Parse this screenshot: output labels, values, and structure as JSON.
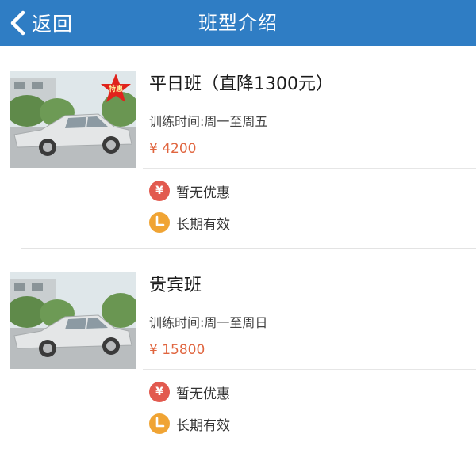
{
  "header": {
    "back_label": "返回",
    "title": "班型介绍",
    "color": "#2f7dc4"
  },
  "classes": [
    {
      "name": "平日班（直降1300元）",
      "schedule": "训练时间:周一至周五",
      "price": "¥ 4200",
      "promo_tag": "特惠",
      "discount_icon": "¥",
      "discount": "暂无优惠",
      "validity": "长期有效"
    },
    {
      "name": "贵宾班",
      "schedule": "训练时间:周一至周日",
      "price": "¥ 15800",
      "discount_icon": "¥",
      "discount": "暂无优惠",
      "validity": "长期有效"
    }
  ],
  "colors": {
    "price": "#e0653f",
    "discount_badge": "#e25a4f",
    "validity_badge": "#f0a434"
  }
}
